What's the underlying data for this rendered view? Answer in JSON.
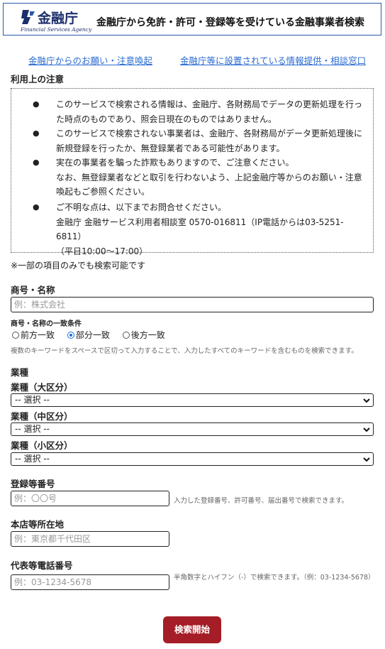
{
  "header": {
    "logo_text": "金融庁",
    "logo_sub": "Financial Services Agency",
    "title": "金融庁から免許・許可・登録等を受けている金融事業者検索"
  },
  "links": {
    "warning": "金融庁からのお願い・注意喚起",
    "consult": "金融庁等に設置されている情報提供・相談窓口"
  },
  "notice": {
    "heading": "利用上の注意",
    "bullet": "●",
    "items": [
      "このサービスで検索される情報は、金融庁、各財務局でデータの更新処理を行った時点のものであり、照会日現在のものではありません。",
      "このサービスで検索されない事業者は、金融庁、各財務局がデータ更新処理後に新規登録を行ったか、無登録業者である可能性があります。",
      "実在の事業者を騙った詐欺もありますので、ご注意ください。\nなお、無登録業者などと取引を行わないよう、上記金融庁等からのお願い・注意喚起もご参照ください。",
      "ご不明な点は、以下までお問合せください。\n金融庁 金融サービス利用者相談室 0570-016811（IP電話からは03-5251-6811）\n（平日10:00～17:00）"
    ]
  },
  "form": {
    "note": "※一部の項目のみでも検索可能です",
    "name_label": "商号・名称",
    "name_placeholder": "例：株式会社",
    "match_label": "商号・名称の一致条件",
    "match_options": [
      "前方一致",
      "部分一致",
      "後方一致"
    ],
    "match_selected": "部分一致",
    "match_help": "複数のキーワードをスペースで区切って入力することで、入力したすべてのキーワードを含むものを検索できます。",
    "industry_label": "業種",
    "industry_large_label": "業種（大区分）",
    "industry_mid_label": "業種（中区分）",
    "industry_small_label": "業種（小区分）",
    "select_default": "-- 選択 --",
    "reg_label": "登録等番号",
    "reg_placeholder": "例：〇〇号",
    "reg_help": "入力した登録番号、許可番号、届出番号で検索できます。",
    "addr_label": "本店等所在地",
    "addr_placeholder": "例：東京都千代田区",
    "tel_label": "代表等電話番号",
    "tel_placeholder": "例：03-1234-5678",
    "tel_help": "半角数字とハイフン（-）で検索できます。（例：03-1234-5678）",
    "submit": "検索開始"
  },
  "colors": {
    "brand_navy": "#1b2f6b",
    "link_blue": "#2a6bd1",
    "button_red": "#a51d26",
    "radio_blue": "#1a6fd9"
  }
}
